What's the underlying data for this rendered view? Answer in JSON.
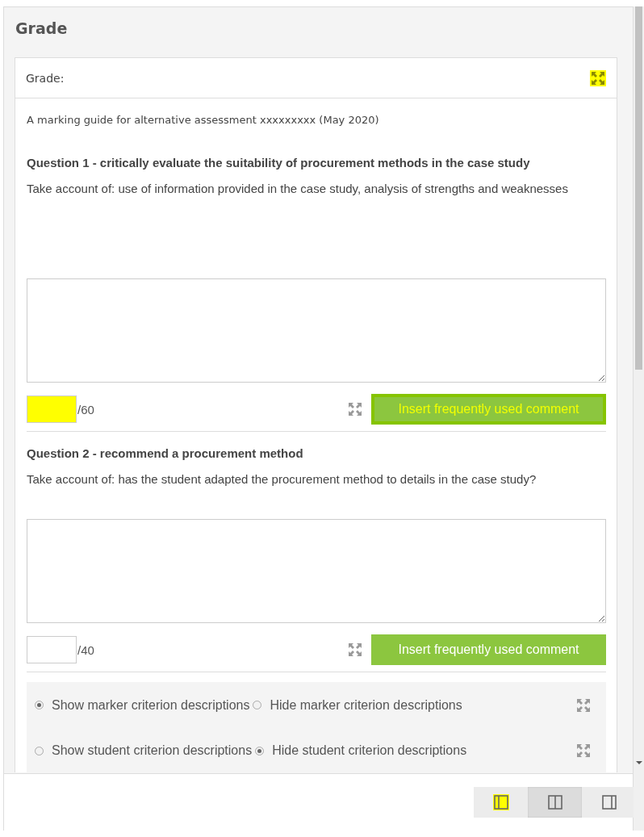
{
  "panel": {
    "title": "Grade"
  },
  "card": {
    "header": "Grade:",
    "expand_highlighted": true,
    "guide_title": "A marking guide for alternative assessment xxxxxxxxx (May 2020)"
  },
  "questions": [
    {
      "title": "Question 1 - critically evaluate the suitability of procurement methods in the case study",
      "description": "Take account of: use of information provided in the case study, analysis of strengths and weaknesses",
      "max_score": "/60",
      "score_highlighted": true,
      "button": "Insert frequently used comment",
      "button_highlighted": true
    },
    {
      "title": "Question 2 - recommend a procurement method",
      "description": "Take account of: has the student adapted the procurement method to details in the case study?",
      "max_score": "/40",
      "score_highlighted": false,
      "button": "Insert frequently used comment",
      "button_highlighted": false
    }
  ],
  "options": [
    [
      {
        "label": "Show marker criterion descriptions",
        "selected": true
      },
      {
        "label": "Hide marker criterion descriptions",
        "selected": false
      }
    ],
    [
      {
        "label": "Show student criterion descriptions",
        "selected": false
      },
      {
        "label": "Hide student criterion descriptions",
        "selected": true
      }
    ]
  ],
  "layout_buttons": [
    {
      "kind": "left",
      "selected": false,
      "highlighted": true
    },
    {
      "kind": "split",
      "selected": true,
      "highlighted": false
    },
    {
      "kind": "right",
      "selected": false,
      "highlighted": false
    }
  ]
}
